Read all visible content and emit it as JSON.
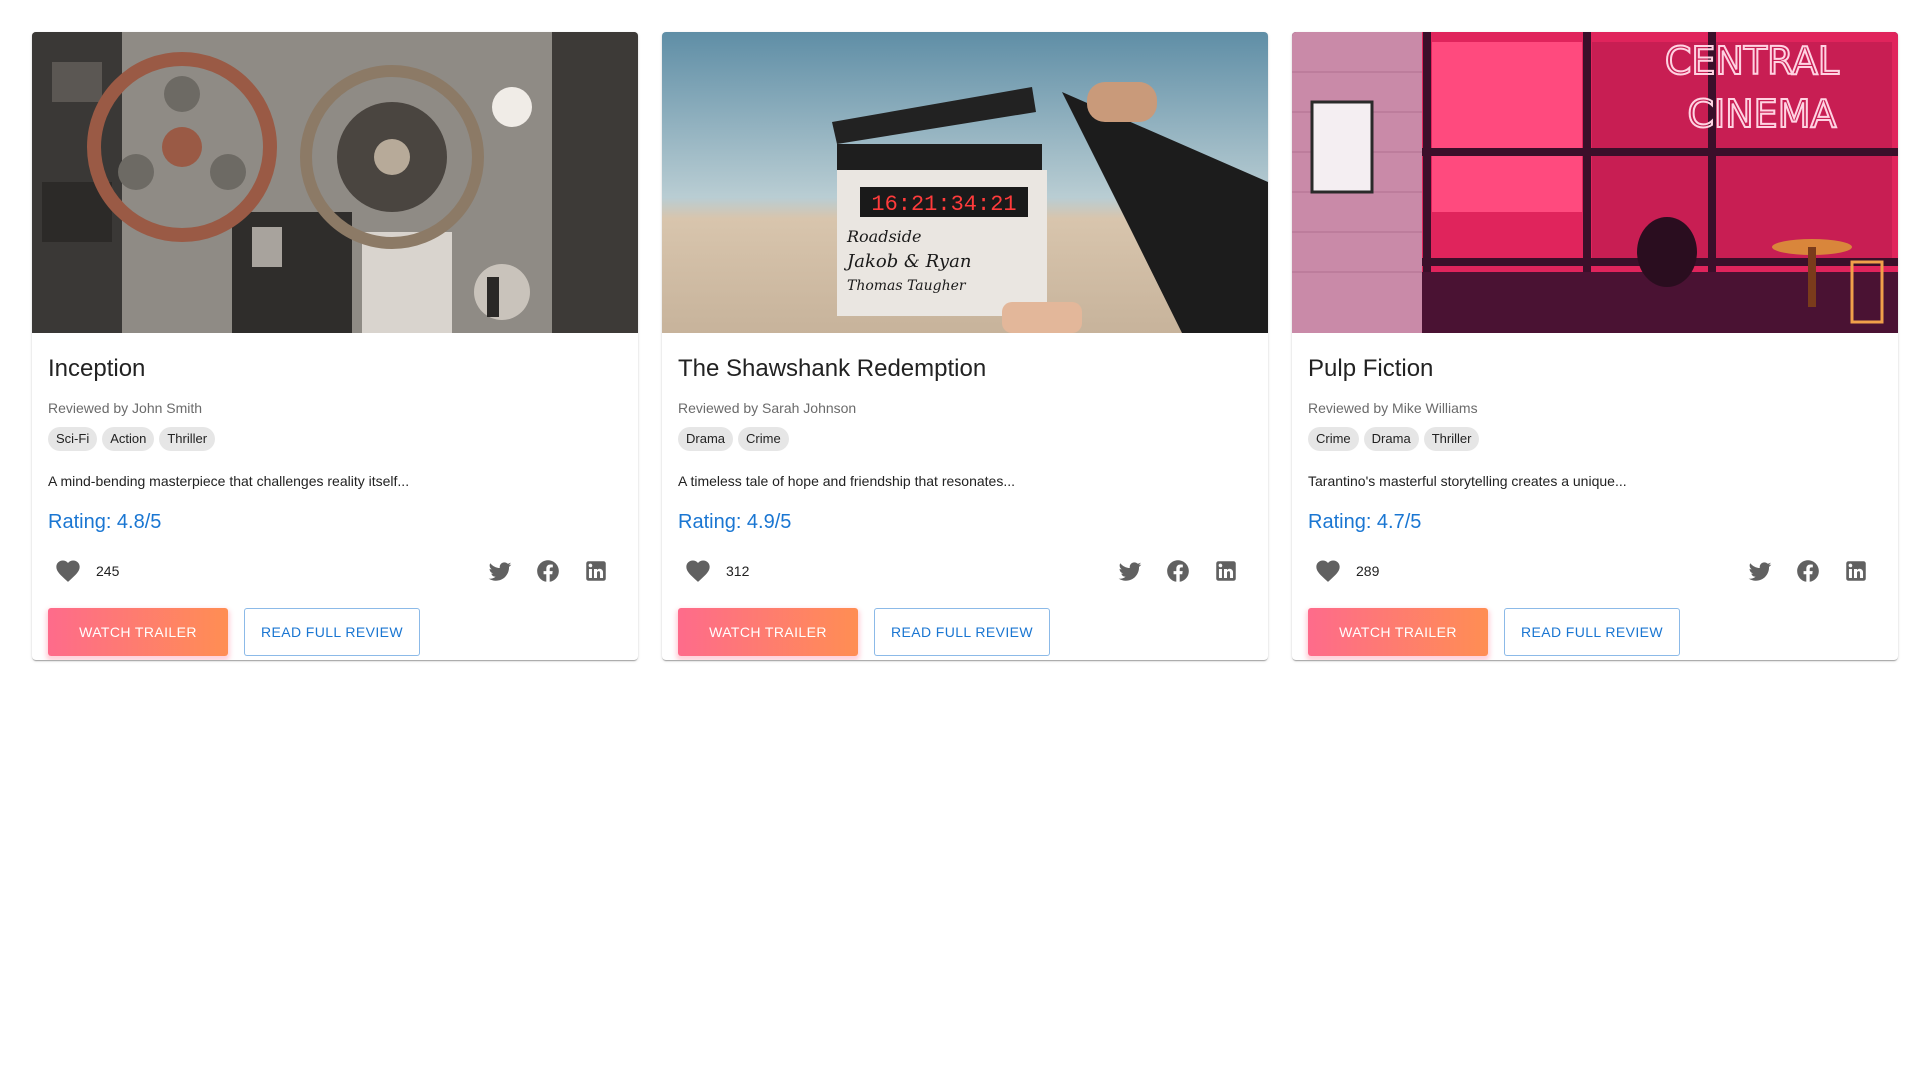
{
  "cards": [
    {
      "title": "Inception",
      "reviewer": "Reviewed by John Smith",
      "genres": [
        "Sci-Fi",
        "Action",
        "Thriller"
      ],
      "description": "A mind-bending masterpiece that challenges reality itself...",
      "rating": "Rating: 4.8/5",
      "likes": "245",
      "image_subject": "vintage film reels and projectors on wall",
      "watch_label": "Watch Trailer",
      "review_label": "Read Full Review"
    },
    {
      "title": "The Shawshank Redemption",
      "reviewer": "Reviewed by Sarah Johnson",
      "genres": [
        "Drama",
        "Crime"
      ],
      "description": "A timeless tale of hope and friendship that resonates...",
      "rating": "Rating: 4.9/5",
      "likes": "312",
      "image_subject": "hand holding clapperboard in desert",
      "clapper_text": [
        "16:21:34:21",
        "Roadside",
        "Jakob & Ryan",
        "Thomas Taugher"
      ],
      "watch_label": "Watch Trailer",
      "review_label": "Read Full Review"
    },
    {
      "title": "Pulp Fiction",
      "reviewer": "Reviewed by Mike Williams",
      "genres": [
        "Crime",
        "Drama",
        "Thriller"
      ],
      "description": "Tarantino's masterful storytelling creates a unique...",
      "rating": "Rating: 4.7/5",
      "likes": "289",
      "image_subject": "pink neon central cinema storefront",
      "neon_text": [
        "CENTRAL",
        "CINEMA"
      ],
      "watch_label": "Watch Trailer",
      "review_label": "Read Full Review"
    }
  ],
  "icons": {
    "like": "heart-icon",
    "twitter": "twitter-icon",
    "facebook": "facebook-icon",
    "linkedin": "linkedin-icon"
  },
  "colors": {
    "rating": "#1a76d2",
    "gradient_start": "#fe6b8b",
    "gradient_end": "#ff8e53"
  }
}
